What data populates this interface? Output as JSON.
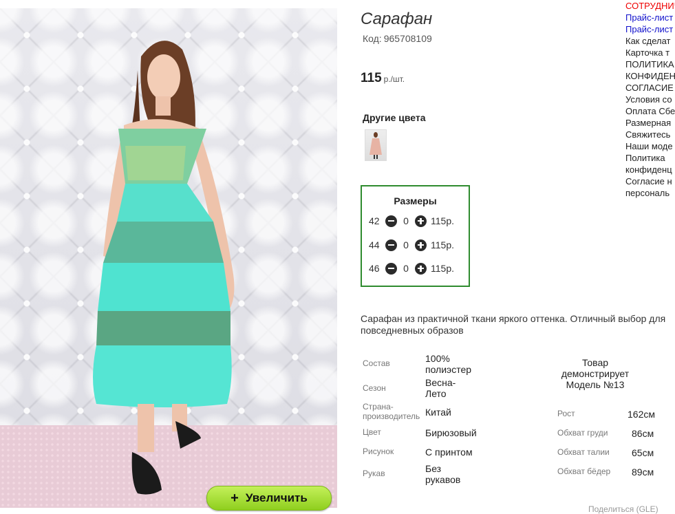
{
  "product": {
    "title": "Сарафан",
    "code_label": "Код:",
    "code": "965708109",
    "price": "115",
    "price_unit": "р./шт.",
    "other_colors_label": "Другие цвета",
    "zoom_button": "Увеличить",
    "zoom_plus": "+"
  },
  "sizes": {
    "header": "Размеры",
    "rows": [
      {
        "size": "42",
        "qty": "0",
        "price": "115р."
      },
      {
        "size": "44",
        "qty": "0",
        "price": "115р."
      },
      {
        "size": "46",
        "qty": "0",
        "price": "115р."
      }
    ]
  },
  "description": "Сарафан из практичной ткани яркого оттенка. Отличный выбор для повседневных образов",
  "attributes": [
    {
      "label": "Состав",
      "value": "100% полиэстер"
    },
    {
      "label": "Сезон",
      "value": "Весна-Лето"
    },
    {
      "label": "Страна-производитель",
      "value": "Китай"
    },
    {
      "label": "Цвет",
      "value": "Бирюзовый"
    },
    {
      "label": "Рисунок",
      "value": "С принтом"
    },
    {
      "label": "Рукав",
      "value": "Без рукавов"
    }
  ],
  "model": {
    "caption": "Товар демонстрирует Модель №13",
    "measurements": [
      {
        "label": "Рост",
        "value": "162см"
      },
      {
        "label": "Обхват груди",
        "value": "86см"
      },
      {
        "label": "Обхват талии",
        "value": "65см"
      },
      {
        "label": "Обхват бёдер",
        "value": "89см"
      }
    ]
  },
  "side_menu": [
    {
      "label": "СОТРУДНИЧ",
      "style": "red"
    },
    {
      "label": "Прайс-лист",
      "style": "blue"
    },
    {
      "label": "Прайс-лист",
      "style": "blue"
    },
    {
      "label": "Как сделат",
      "style": "normal"
    },
    {
      "label": "Карточка т",
      "style": "normal"
    },
    {
      "label": "ПОЛИТИКА",
      "style": "normal"
    },
    {
      "label": "КОНФИДЕН",
      "style": "normal"
    },
    {
      "label": "СОГЛАСИЕ",
      "style": "normal"
    },
    {
      "label": "Условия со",
      "style": "normal"
    },
    {
      "label": "Оплата Сбе",
      "style": "normal"
    },
    {
      "label": "Размерная",
      "style": "normal"
    },
    {
      "label": "Свяжитесь",
      "style": "normal"
    },
    {
      "label": "Наши моде",
      "style": "normal"
    },
    {
      "label": "Политика",
      "style": "normal"
    },
    {
      "label": "конфиденц",
      "style": "normal"
    },
    {
      "label": "Согласие н",
      "style": "normal"
    },
    {
      "label": "персональ",
      "style": "normal"
    }
  ],
  "footer_note": "Поделиться (GLE)"
}
